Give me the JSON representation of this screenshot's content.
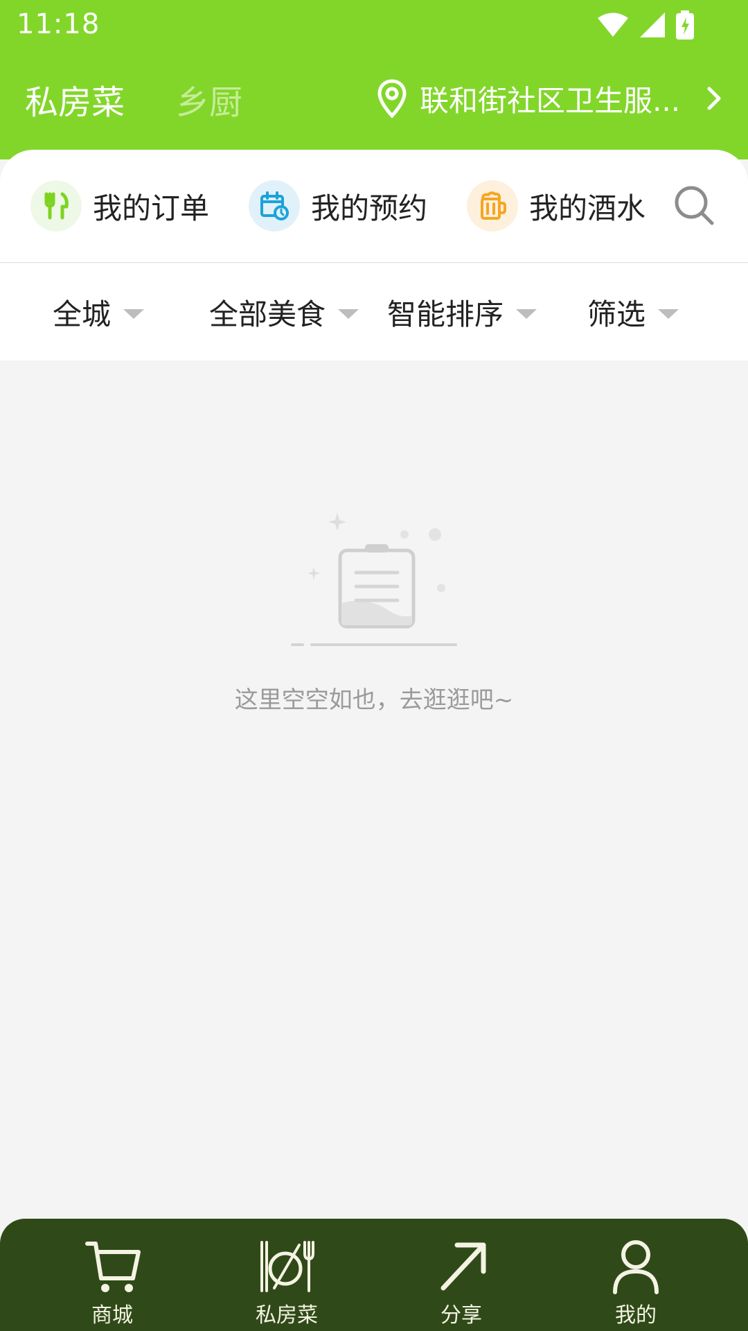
{
  "status_bar": {
    "time": "11:18"
  },
  "header": {
    "tabs": [
      "私房菜",
      "乡厨"
    ],
    "location": "联和街社区卫生服..."
  },
  "quick_actions": [
    {
      "label": "我的订单",
      "icon": "utensils-icon",
      "color": "#7ed321"
    },
    {
      "label": "我的预约",
      "icon": "calendar-clock-icon",
      "color": "#1aa3d9"
    },
    {
      "label": "我的酒水",
      "icon": "beer-mug-icon",
      "color": "#f5a623"
    }
  ],
  "filters": [
    "全城",
    "全部美食",
    "智能排序",
    "筛选"
  ],
  "empty_state": {
    "message": "这里空空如也，去逛逛吧~"
  },
  "bottom_nav": [
    {
      "label": "商城",
      "icon": "cart-icon"
    },
    {
      "label": "私房菜",
      "icon": "plate-cutlery-icon"
    },
    {
      "label": "分享",
      "icon": "share-arrow-icon"
    },
    {
      "label": "我的",
      "icon": "user-icon"
    }
  ],
  "colors": {
    "header_green": "#82d62a",
    "nav_dark_green": "#2f4a18",
    "inactive_tab": "#c6ec98"
  }
}
